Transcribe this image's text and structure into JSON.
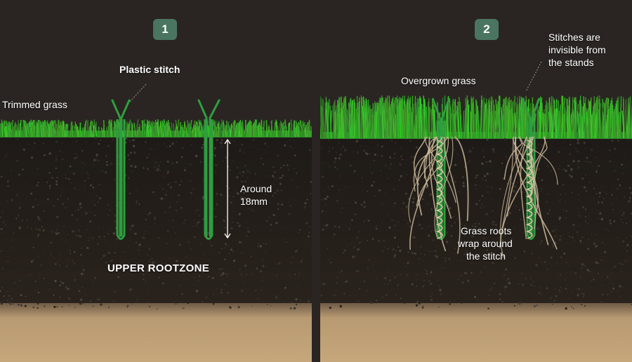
{
  "panels": [
    {
      "badge": "1",
      "labels": {
        "trimmed_grass": "Trimmed grass",
        "plastic_stitch": "Plastic stitch",
        "around": "Around",
        "measure": "18mm",
        "zone": "UPPER ROOTZONE"
      }
    },
    {
      "badge": "2",
      "labels": {
        "overgrown_grass": "Overgrown grass",
        "stitches_line1": "Stitches are",
        "stitches_line2": "invisible from",
        "stitches_line3": "the stands",
        "roots_line1": "Grass roots",
        "roots_line2": "wrap around",
        "roots_line3": "the stitch"
      }
    }
  ],
  "colors": {
    "background": "#2a2522",
    "soil": "#1f1b18",
    "sand": "#b89a72",
    "grass": "#3fb53a",
    "stitch": "#2e9e3e",
    "roots": "#c9b89a",
    "badge": "#4a7560"
  }
}
